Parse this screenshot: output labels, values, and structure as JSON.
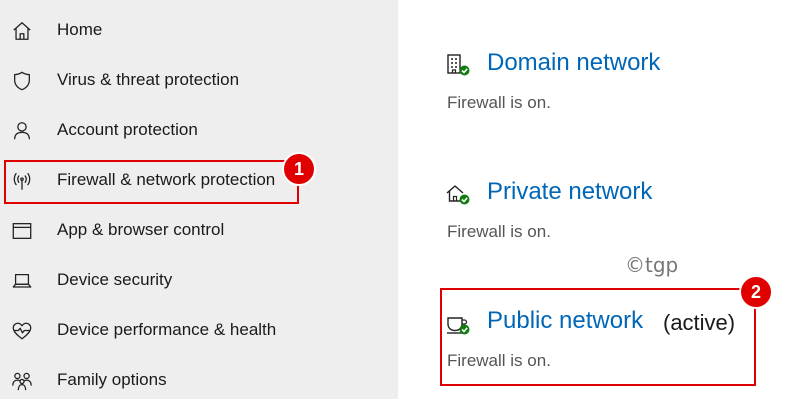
{
  "sidebar": {
    "items": [
      {
        "label": "Home",
        "icon": "home-icon"
      },
      {
        "label": "Virus & threat protection",
        "icon": "shield-icon"
      },
      {
        "label": "Account protection",
        "icon": "person-icon"
      },
      {
        "label": "Firewall & network protection",
        "icon": "antenna-icon"
      },
      {
        "label": "App & browser control",
        "icon": "browser-window-icon"
      },
      {
        "label": "Device security",
        "icon": "laptop-icon"
      },
      {
        "label": "Device performance & health",
        "icon": "heart-pulse-icon"
      },
      {
        "label": "Family options",
        "icon": "family-icon"
      }
    ]
  },
  "networks": [
    {
      "title": "Domain network",
      "status": "Firewall is on.",
      "icon": "domain-network-icon"
    },
    {
      "title": "Private network",
      "status": "Firewall is on.",
      "icon": "private-network-icon"
    },
    {
      "title": "Public network",
      "active_label": "(active)",
      "status": "Firewall is on.",
      "icon": "public-network-icon"
    }
  ],
  "annotations": {
    "badge_1": "1",
    "badge_2": "2",
    "watermark": "©tgp"
  },
  "colors": {
    "accent": "#0067b8",
    "annotation_red": "#e00000",
    "sidebar_bg": "#eeeeee",
    "status_green": "#107c10"
  }
}
